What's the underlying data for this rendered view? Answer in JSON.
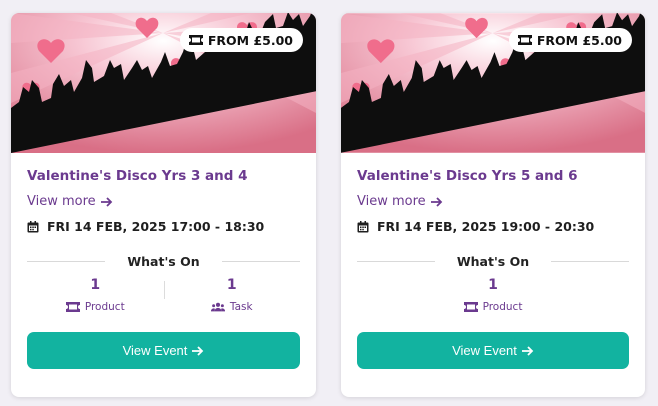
{
  "colors": {
    "accent": "#12b3a0",
    "brand": "#6b3a8f",
    "background": "#f1eff5"
  },
  "events": [
    {
      "price": "FROM £5.00",
      "title": "Valentine's Disco Yrs 3 and 4",
      "view_more": "View more",
      "date": "FRI 14 FEB, 2025 17:00 - 18:30",
      "whats_on": "What's On",
      "stats": [
        {
          "count": "1",
          "label": "Product",
          "icon": "ticket-icon"
        },
        {
          "count": "1",
          "label": "Task",
          "icon": "users-icon"
        }
      ],
      "button": "View Event"
    },
    {
      "price": "FROM £5.00",
      "title": "Valentine's Disco Yrs 5 and 6",
      "view_more": "View more",
      "date": "FRI 14 FEB, 2025 19:00 - 20:30",
      "whats_on": "What's On",
      "stats": [
        {
          "count": "1",
          "label": "Product",
          "icon": "ticket-icon"
        }
      ],
      "button": "View Event"
    }
  ]
}
